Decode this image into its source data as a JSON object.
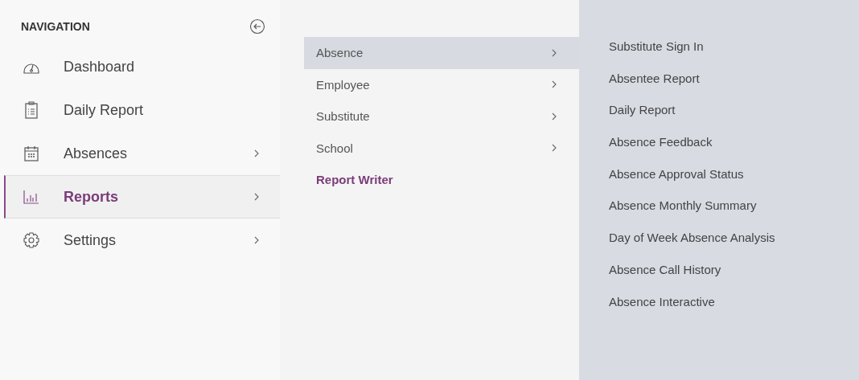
{
  "navigation": {
    "title": "NAVIGATION",
    "items": [
      {
        "label": "Dashboard",
        "has_submenu": false,
        "selected": false
      },
      {
        "label": "Daily Report",
        "has_submenu": false,
        "selected": false
      },
      {
        "label": "Absences",
        "has_submenu": true,
        "selected": false
      },
      {
        "label": "Reports",
        "has_submenu": true,
        "selected": true
      },
      {
        "label": "Settings",
        "has_submenu": true,
        "selected": false
      }
    ]
  },
  "report_menu": {
    "items": [
      {
        "label": "Absence",
        "kind": "submenu",
        "selected": true
      },
      {
        "label": "Employee",
        "kind": "submenu",
        "selected": false
      },
      {
        "label": "Substitute",
        "kind": "submenu",
        "selected": false
      },
      {
        "label": "School",
        "kind": "submenu",
        "selected": false
      },
      {
        "label": "Report Writer",
        "kind": "link",
        "selected": false
      }
    ]
  },
  "absence_reports": {
    "items": [
      "Substitute Sign In",
      "Absentee Report",
      "Daily Report",
      "Absence Feedback",
      "Absence Approval Status",
      "Absence Monthly Summary",
      "Day of Week Absence Analysis",
      "Absence Call History",
      "Absence Interactive"
    ]
  }
}
